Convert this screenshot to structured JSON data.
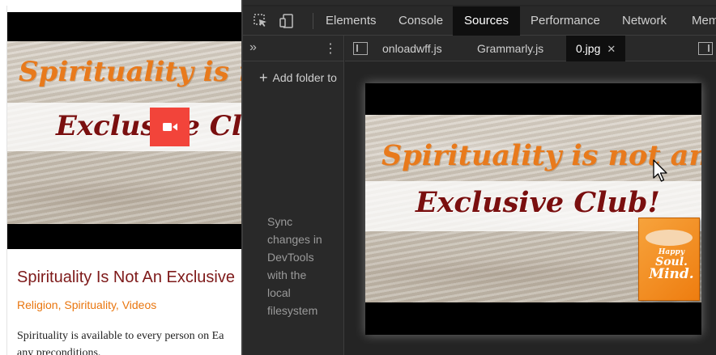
{
  "webpage": {
    "video": {
      "line1": "Spirituality is not",
      "line2": "Exclusive Club"
    },
    "post": {
      "title": "Spirituality Is Not An Exclusive",
      "categories": [
        "Religion",
        "Spirituality",
        "Videos"
      ],
      "excerpt": "Spirituality is available to every person on Ea\nany preconditions."
    },
    "colors": {
      "title": "#7e1a1a",
      "categories": "#e9760f",
      "play_button": "#f2443a"
    }
  },
  "devtools": {
    "toolbar": {
      "inspect_icon": "inspect-element-icon",
      "device_icon": "device-toolbar-icon",
      "tabs": [
        "Elements",
        "Console",
        "Sources",
        "Performance",
        "Network",
        "Mem"
      ],
      "active_tab": "Sources"
    },
    "navigator": {
      "more_label": "»",
      "menu_label": "⋮",
      "add_folder_label": "Add folder to",
      "sync_message": "Sync changes in DevTools with the local filesystem"
    },
    "editor": {
      "file_tabs": [
        "onloadwff.js",
        "Grammarly.js",
        "0.jpg"
      ],
      "active_file": "0.jpg",
      "close_label": "✕",
      "preview": {
        "line1": "Spirituality is not an",
        "line2": "Exclusive Club!",
        "book": {
          "line_a": "Happy",
          "line_b": "Soul.",
          "line_c": "Mind."
        }
      }
    }
  }
}
